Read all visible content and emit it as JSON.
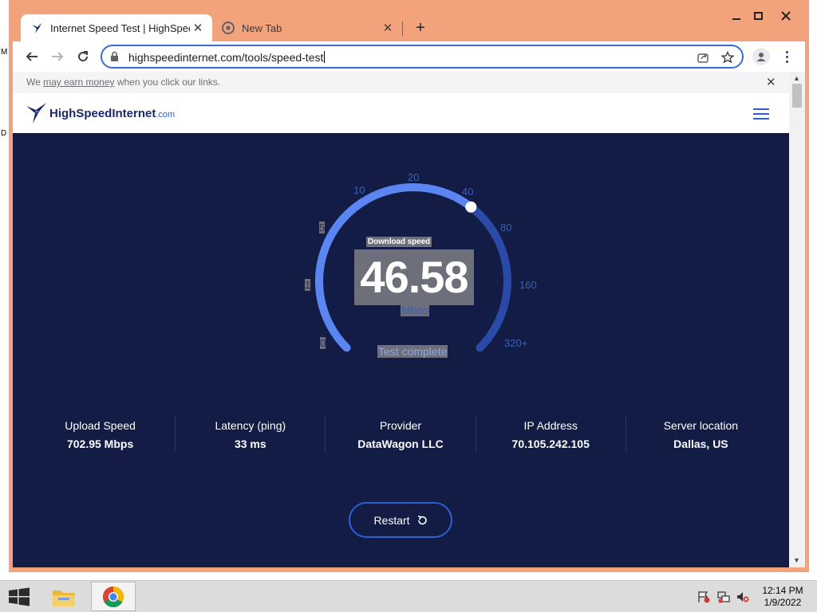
{
  "browser": {
    "tabs": [
      {
        "title": "Internet Speed Test | HighSpeedI",
        "active": true
      },
      {
        "title": "New Tab",
        "active": false
      }
    ],
    "new_tab_symbol": "+",
    "url": "highspeedinternet.com/tools/speed-test"
  },
  "site": {
    "disclaimer_prefix": "We ",
    "disclaimer_link": "may earn money",
    "disclaimer_suffix": " when you click our links.",
    "logo_name": "HighSpeedInternet",
    "logo_suffix": ".com"
  },
  "speed_test": {
    "label": "Download speed",
    "value": "46.58",
    "unit": "Mbps",
    "status": "Test complete",
    "gauge_ticks": [
      "0",
      "1",
      "5",
      "10",
      "20",
      "40",
      "80",
      "160",
      "320+"
    ],
    "gauge_fraction": 0.64,
    "colors": {
      "arc": "#5b86f2",
      "track": "#2b4aa8",
      "panel": "#121c45"
    }
  },
  "stats": [
    {
      "label": "Upload Speed",
      "value": "702.95 Mbps"
    },
    {
      "label": "Latency (ping)",
      "value": "33 ms"
    },
    {
      "label": "Provider",
      "value": "DataWagon LLC"
    },
    {
      "label": "IP Address",
      "value": "70.105.242.105"
    },
    {
      "label": "Server location",
      "value": "Dallas, US"
    }
  ],
  "restart_label": "Restart",
  "taskbar": {
    "time": "12:14 PM",
    "date": "1/9/2022"
  }
}
